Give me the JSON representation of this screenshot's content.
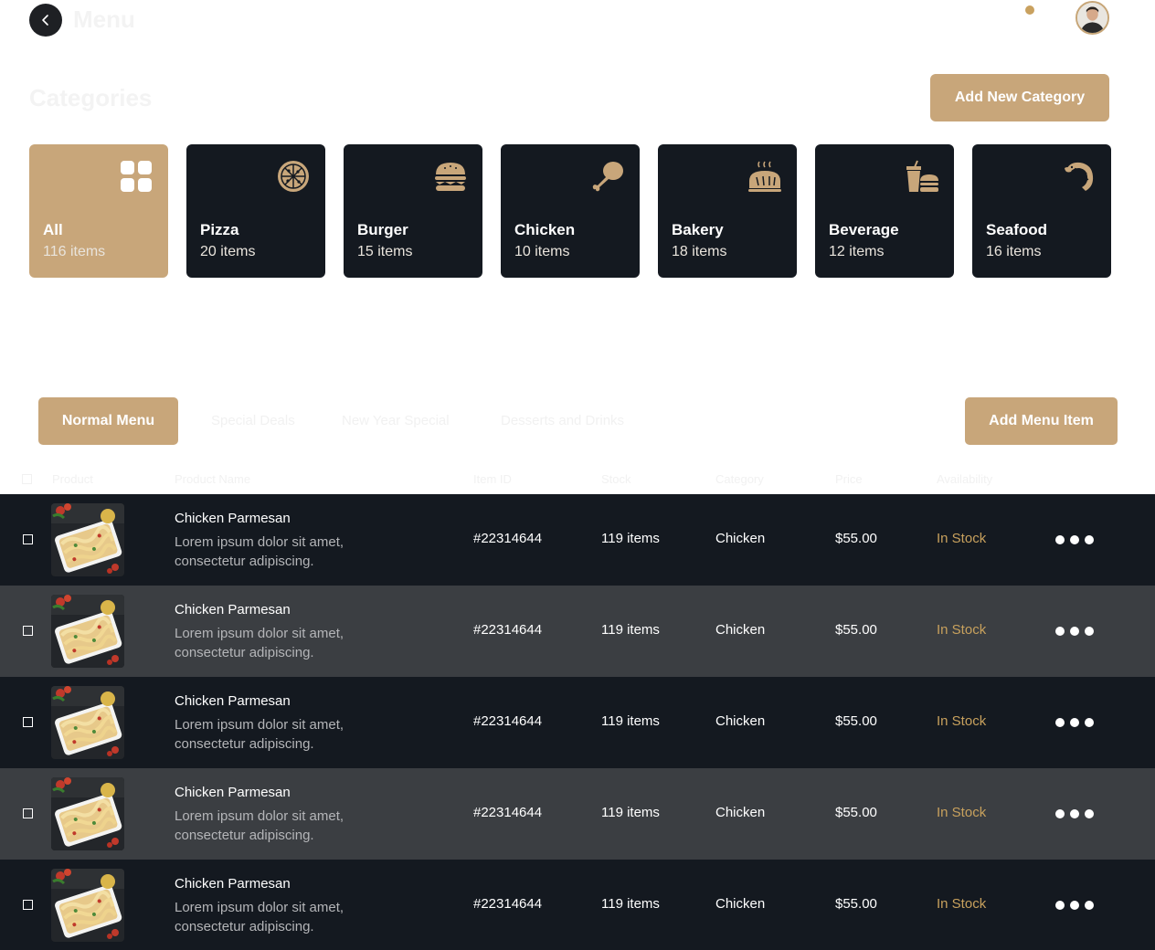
{
  "header": {
    "title": "Menu"
  },
  "categories_section": {
    "title": "Categories",
    "add_button": "Add New Category",
    "items": [
      {
        "name": "All",
        "count": "116 items",
        "icon": "grid-icon"
      },
      {
        "name": "Pizza",
        "count": "20 items",
        "icon": "pizza-icon"
      },
      {
        "name": "Burger",
        "count": "15 items",
        "icon": "burger-icon"
      },
      {
        "name": "Chicken",
        "count": "10 items",
        "icon": "chicken-leg-icon"
      },
      {
        "name": "Bakery",
        "count": "18 items",
        "icon": "bread-icon"
      },
      {
        "name": "Beverage",
        "count": "12 items",
        "icon": "drink-icon"
      },
      {
        "name": "Seafood",
        "count": "16 items",
        "icon": "shrimp-icon"
      }
    ]
  },
  "tabs": [
    "Normal Menu",
    "Special Deals",
    "New Year Special",
    "Desserts and Drinks"
  ],
  "add_item_button": "Add Menu Item",
  "table": {
    "headers": {
      "product": "Product",
      "product_name": "Product Name",
      "item_id": "Item ID",
      "stock": "Stock",
      "category": "Category",
      "price": "Price",
      "availability": "Availability"
    },
    "rows": [
      {
        "name": "Chicken Parmesan",
        "desc": "Lorem ipsum dolor sit amet, consectetur adipiscing.",
        "id": "#22314644",
        "stock": "119 items",
        "category": "Chicken",
        "price": "$55.00",
        "availability": "In Stock"
      },
      {
        "name": "Chicken Parmesan",
        "desc": "Lorem ipsum dolor sit amet, consectetur adipiscing.",
        "id": "#22314644",
        "stock": "119 items",
        "category": "Chicken",
        "price": "$55.00",
        "availability": "In Stock"
      },
      {
        "name": "Chicken Parmesan",
        "desc": "Lorem ipsum dolor sit amet, consectetur adipiscing.",
        "id": "#22314644",
        "stock": "119 items",
        "category": "Chicken",
        "price": "$55.00",
        "availability": "In Stock"
      },
      {
        "name": "Chicken Parmesan",
        "desc": "Lorem ipsum dolor sit amet, consectetur adipiscing.",
        "id": "#22314644",
        "stock": "119 items",
        "category": "Chicken",
        "price": "$55.00",
        "availability": "In Stock"
      },
      {
        "name": "Chicken Parmesan",
        "desc": "Lorem ipsum dolor sit amet, consectetur adipiscing.",
        "id": "#22314644",
        "stock": "119 items",
        "category": "Chicken",
        "price": "$55.00",
        "availability": "In Stock"
      }
    ]
  },
  "colors": {
    "accent": "#c8a67a",
    "dark": "#141920",
    "row_alt": "#3b3e42",
    "stock_text": "#c8a15d"
  }
}
